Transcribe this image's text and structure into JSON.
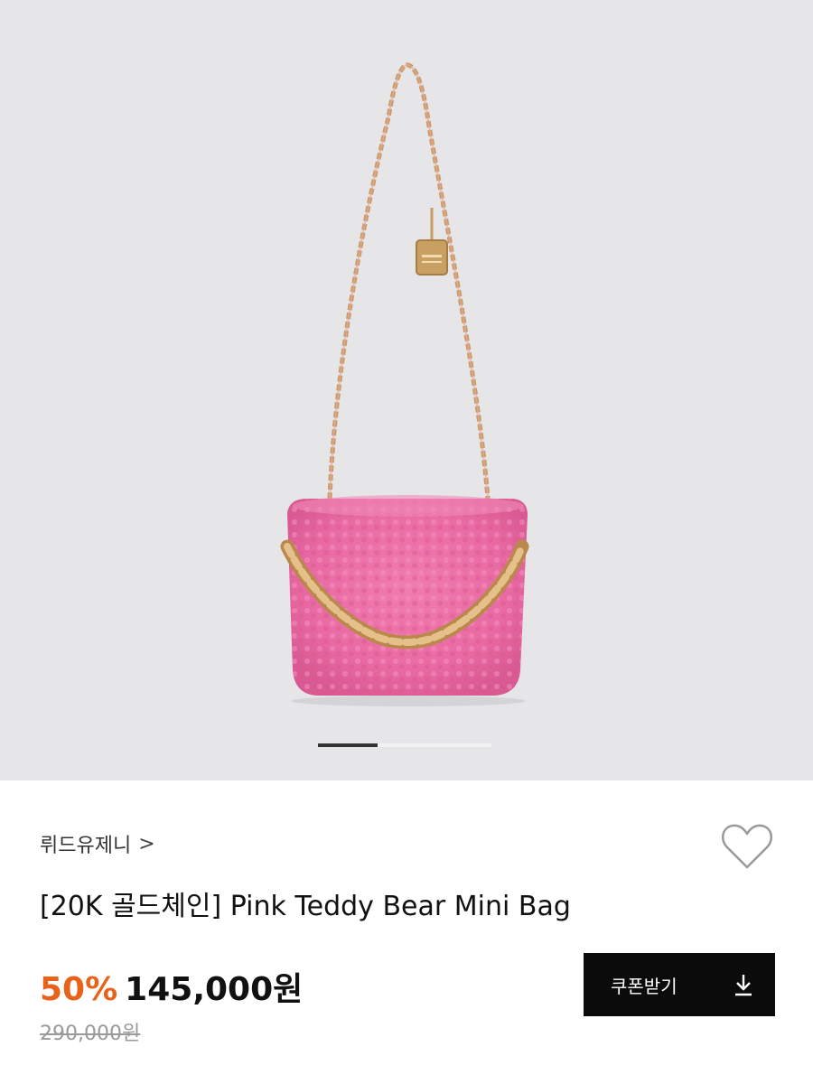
{
  "product": {
    "brand": "뤼드유제니",
    "brand_chevron": ">",
    "title": "[20K 골드체인] Pink Teddy Bear Mini Bag",
    "discount": "50%",
    "price": "145,000원",
    "original_price": "290,000원",
    "wishlist_icon": "heart-outline-icon"
  },
  "gallery": {
    "active_index": 1,
    "total_images": 3
  },
  "coupon_button": {
    "label": "쿠폰받기",
    "icon": "download-icon"
  },
  "colors": {
    "discount": "#e8621a",
    "button_bg": "#0b0b0b",
    "hero_bg": "#e6e6e8",
    "bag_pink": "#ec74a8",
    "chain_gold": "#c99a63"
  }
}
